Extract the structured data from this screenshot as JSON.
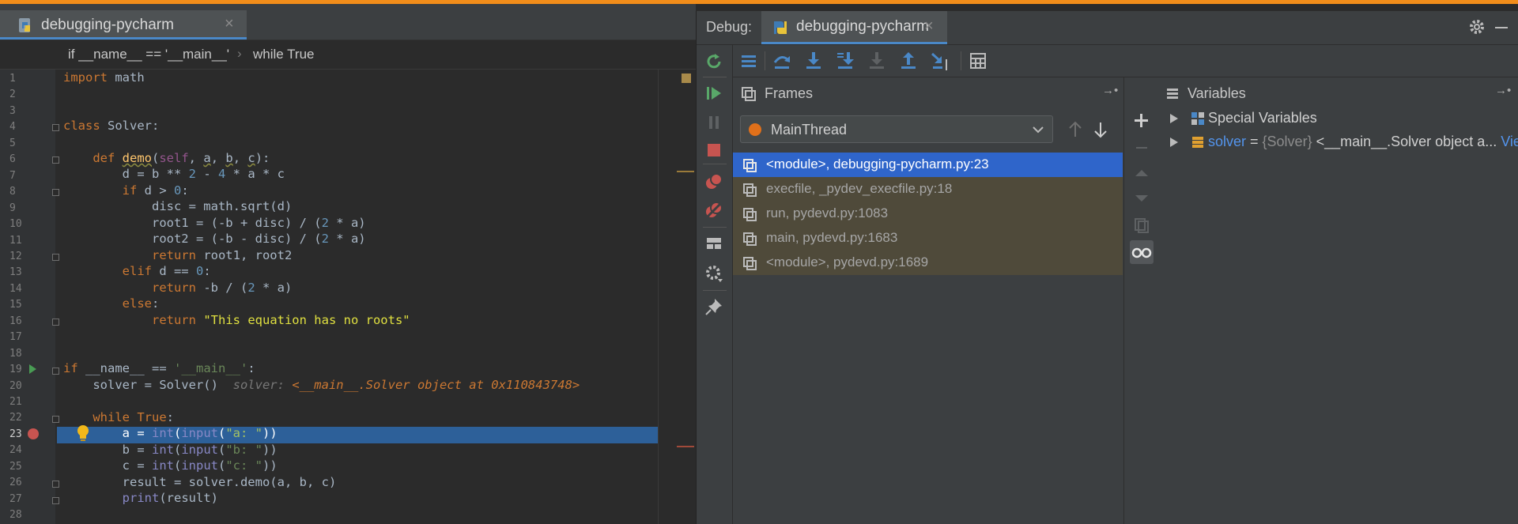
{
  "editor": {
    "tab": {
      "label": "debugging-pycharm",
      "close": "×"
    },
    "breadcrumb": [
      "if __name__ == '__main__'",
      "while True"
    ],
    "breadcrumb_sep": "›",
    "line_numbers": [
      "1",
      "2",
      "3",
      "4",
      "5",
      "6",
      "7",
      "8",
      "9",
      "10",
      "11",
      "12",
      "13",
      "14",
      "15",
      "16",
      "17",
      "18",
      "19",
      "20",
      "21",
      "22",
      "23",
      "24",
      "25",
      "26",
      "27",
      "28"
    ],
    "current_line": "23",
    "inline_hint": {
      "label": "solver:",
      "value": "<__main__.Solver object at 0x110843748>"
    }
  },
  "debug": {
    "title": "Debug:",
    "tab": {
      "label": "debugging-pycharm",
      "close": "×"
    },
    "frames_panel": {
      "title": "Frames",
      "pin": "→•",
      "thread": "MainThread",
      "items": [
        {
          "label": "<module>, debugging-pycharm.py:23",
          "selected": true
        },
        {
          "label": "execfile, _pydev_execfile.py:18",
          "selected": false
        },
        {
          "label": "run, pydevd.py:1083",
          "selected": false
        },
        {
          "label": "main, pydevd.py:1683",
          "selected": false
        },
        {
          "label": "<module>, pydevd.py:1689",
          "selected": false
        }
      ]
    },
    "variables_panel": {
      "title": "Variables",
      "pin": "→•",
      "special": "Special Variables",
      "solver": {
        "name": "solver",
        "eq": " = ",
        "type": "{Solver}",
        "value": " <__main__.Solver object a",
        "ellipsis": "...",
        "link": " View"
      }
    }
  },
  "colors": {
    "accent_stripe": "#f28d1a",
    "selection": "#2f65ca",
    "execution_line": "#2d6099",
    "breakpoint": "#c75450"
  }
}
